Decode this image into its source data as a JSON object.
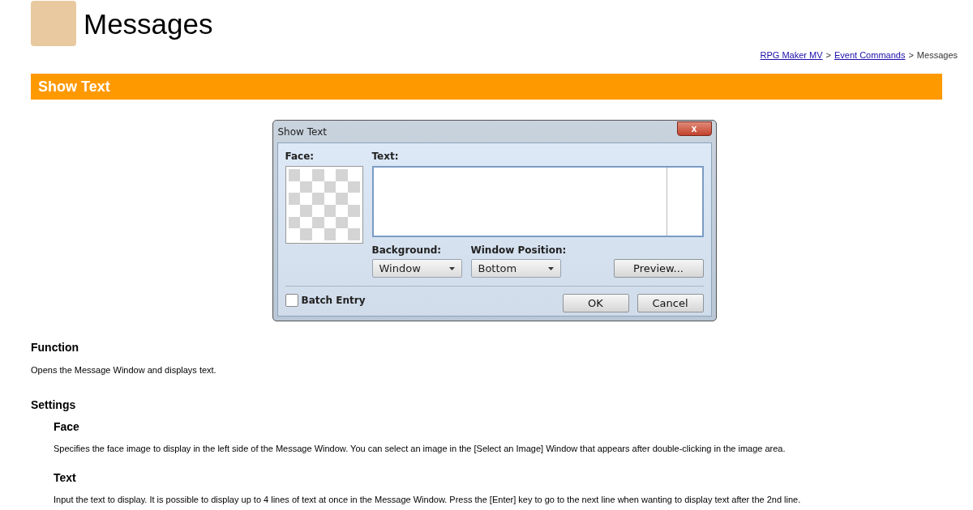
{
  "page_title": "Messages",
  "breadcrumb": [
    {
      "kind": "link",
      "text": "RPG Maker MV"
    },
    {
      "kind": "sep",
      "text": ">"
    },
    {
      "kind": "link",
      "text": "Event Commands"
    },
    {
      "kind": "sep",
      "text": ">"
    },
    {
      "kind": "current",
      "text": "Messages"
    }
  ],
  "section_title": "Show Text",
  "dialog": {
    "title": "Show Text",
    "close": "x",
    "face_label": "Face:",
    "text_label": "Text:",
    "background_label": "Background:",
    "background_value": "Window",
    "position_label": "Window Position:",
    "position_value": "Bottom",
    "preview_button": "Preview...",
    "batch_entry": {
      "label": "Batch Entry",
      "checked": false
    },
    "ok_button": "OK",
    "cancel_button": "Cancel"
  },
  "function": {
    "heading": "Function",
    "text": "Opens the Message Window and displays text."
  },
  "settings": {
    "heading": "Settings",
    "items": [
      {
        "heading": "Face",
        "text": "Specifies the face image to display in the left side of the Message Window. You can select an image in the [Select an Image] Window that appears after double-clicking in the image area."
      },
      {
        "heading": "Text",
        "text": "Input the text to display. It is possible to display up to 4 lines of text at once in the Message Window. Press the [Enter] key to go to the next line when wanting to display text after the 2nd line."
      }
    ]
  }
}
